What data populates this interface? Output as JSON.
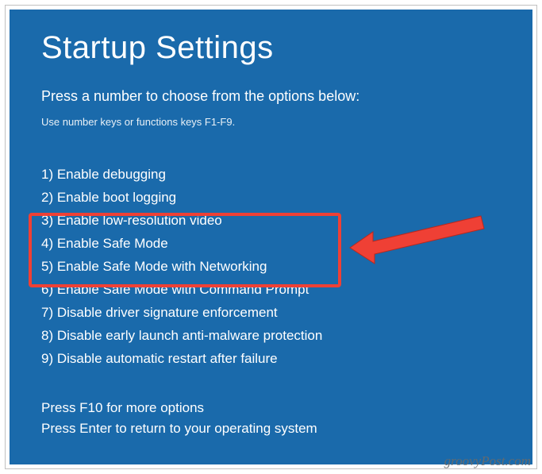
{
  "title": "Startup Settings",
  "subtitle": "Press a number to choose from the options below:",
  "hint": "Use number keys or functions keys F1-F9.",
  "options": [
    "1) Enable debugging",
    "2) Enable boot logging",
    "3) Enable low-resolution video",
    "4) Enable Safe Mode",
    "5) Enable Safe Mode with Networking",
    "6) Enable Safe Mode with Command Prompt",
    "7) Disable driver signature enforcement",
    "8) Disable early launch anti-malware protection",
    "9) Disable automatic restart after failure"
  ],
  "footer_more": "Press F10 for more options",
  "footer_return": "Press Enter to return to your operating system",
  "watermark": "groovyPost.com"
}
